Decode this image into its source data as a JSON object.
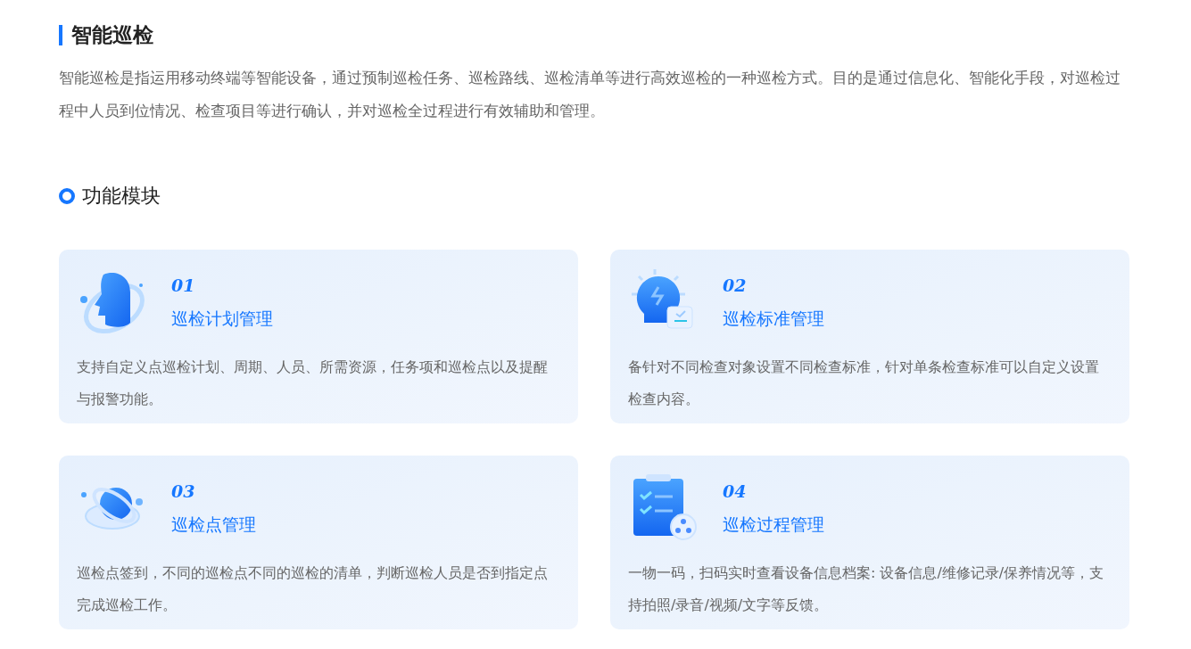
{
  "title": "智能巡检",
  "intro": "智能巡检是指运用移动终端等智能设备，通过预制巡检任务、巡检路线、巡检清单等进行高效巡检的一种巡检方式。目的是通过信息化、智能化手段，对巡检过程中人员到位情况、检查项目等进行确认，并对巡检全过程进行有效辅助和管理。",
  "section": "功能模块",
  "modules": [
    {
      "kind": "head",
      "number": "01",
      "name": "巡检计划管理",
      "description": "支持自定义点巡检计划、周期、人员、所需资源，任务项和巡检点以及提醒与报警功能。"
    },
    {
      "kind": "bulb",
      "number": "02",
      "name": "巡检标准管理",
      "description": "备针对不同检查对象设置不同检查标准，针对单条检查标准可以自定义设置检查内容。"
    },
    {
      "kind": "planet",
      "number": "03",
      "name": "巡检点管理",
      "description": "巡检点签到，不同的巡检点不同的巡检的清单，判断巡检人员是否到指定点完成巡检工作。"
    },
    {
      "kind": "clipboard",
      "number": "04",
      "name": "巡检过程管理",
      "description": "一物一码，扫码实时查看设备信息档案: 设备信息/维修记录/保养情况等，支持拍照/录音/视频/文字等反馈。"
    }
  ]
}
